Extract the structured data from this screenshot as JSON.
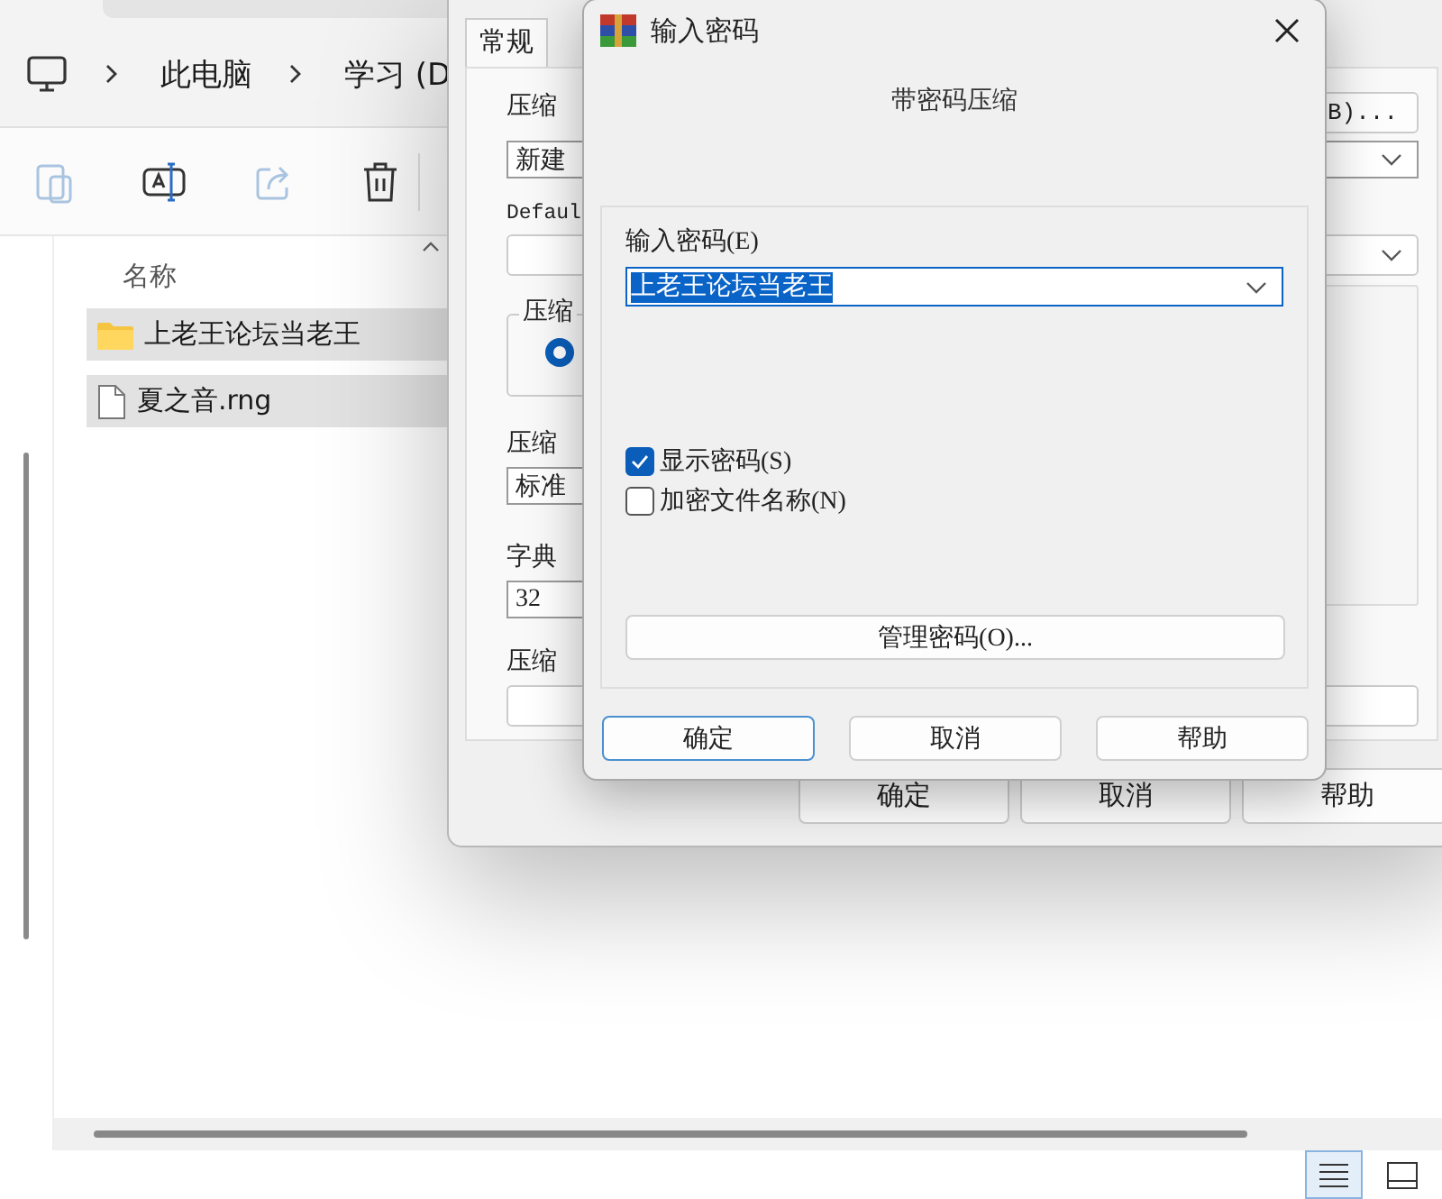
{
  "explorer": {
    "breadcrumb": [
      {
        "label": "此电脑"
      },
      {
        "label": "学习 (D"
      }
    ],
    "toolbar": [
      {
        "kind": "paste",
        "disabled": true
      },
      {
        "kind": "rename",
        "disabled": false
      },
      {
        "kind": "share",
        "disabled": true
      },
      {
        "kind": "delete",
        "disabled": false
      }
    ],
    "column_header": "名称",
    "files": [
      {
        "name": "上老王论坛当老王",
        "kind": "folder",
        "selected": true
      },
      {
        "name": "夏之音.rng",
        "kind": "file",
        "selected": true
      }
    ],
    "view_buttons": [
      {
        "kind": "details",
        "selected": true
      },
      {
        "kind": "preview",
        "selected": false
      }
    ]
  },
  "archive_dialog": {
    "tabs": [
      {
        "label": "常规",
        "selected": true
      }
    ],
    "archive_name_label": "压缩",
    "browse_button": "B)...",
    "archive_name": "新建",
    "profile_label": "Defaul",
    "format_group": "压缩",
    "format_radio": {
      "selected": true
    },
    "method_label": "压缩",
    "method": "标准",
    "dictionary_label": "字典",
    "dictionary": "32",
    "split_label": "压缩",
    "buttons": [
      "确定",
      "取消",
      "帮助"
    ]
  },
  "password_dialog": {
    "title": "输入密码",
    "subtitle": "带密码压缩",
    "password_label": "输入密码(E)",
    "password": "上老王论坛当老王",
    "password_highlighted": true,
    "options": [
      {
        "label": "显示密码(S)",
        "checked": true
      },
      {
        "label": "加密文件名称(N)",
        "checked": false
      }
    ],
    "manage_button": "管理密码(O)...",
    "buttons": [
      {
        "label": "确定",
        "focused": true
      },
      {
        "label": "取消",
        "focused": false
      },
      {
        "label": "帮助",
        "focused": false
      }
    ]
  }
}
